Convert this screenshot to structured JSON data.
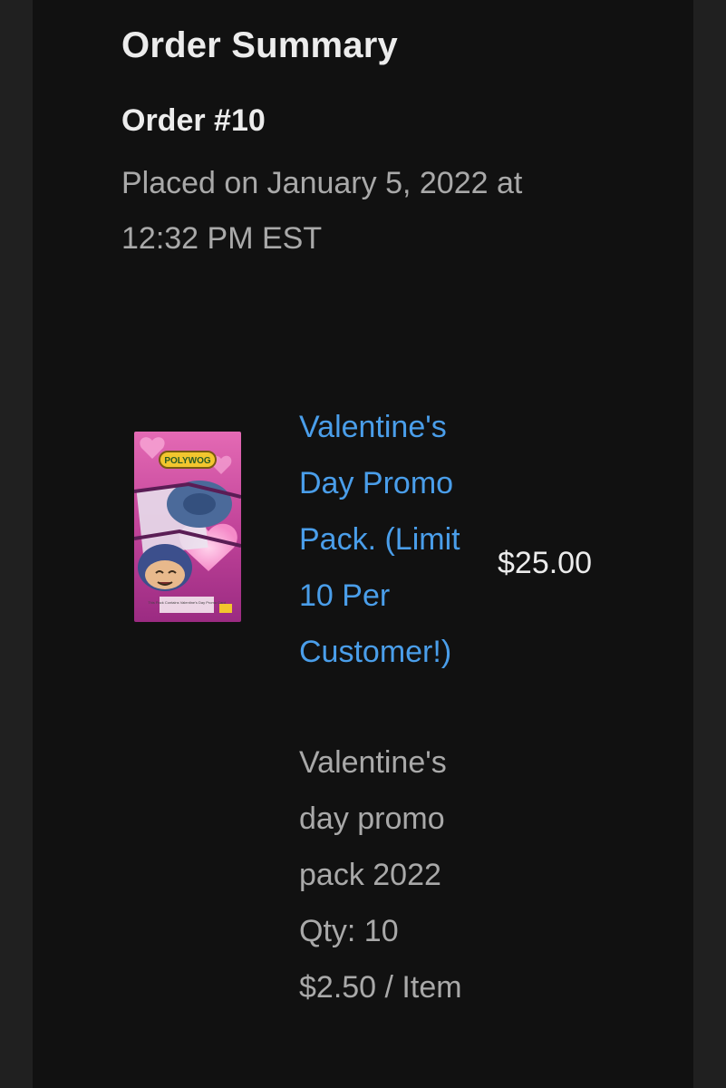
{
  "order": {
    "title": "Order Summary",
    "number": "Order #10",
    "placed_on": "Placed on January 5, 2022 at 12:32 PM EST"
  },
  "item": {
    "image_logo_text": "POLYWOG",
    "image_caption": "This Pack Contains Valentine's Day Promo Card",
    "name": "Valentine's Day Promo Pack. (Limit 10 Per Customer!)",
    "price": "$25.00",
    "description": "Valentine's day promo pack 2022",
    "quantity": "Qty: 10",
    "unit_price": "$2.50 / Item"
  },
  "colors": {
    "background": "#111111",
    "link": "#4a9eea",
    "text_primary": "#ececec",
    "text_secondary": "#a9a9a9"
  }
}
